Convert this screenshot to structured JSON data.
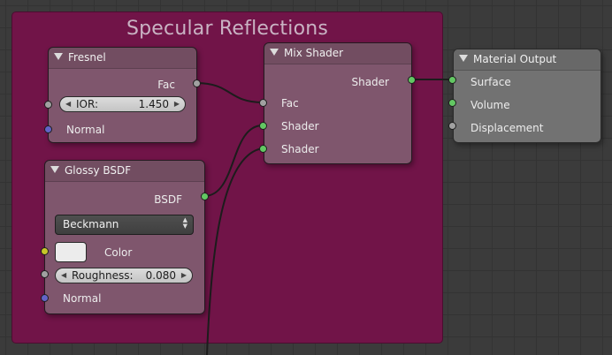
{
  "frame": {
    "title": "Specular Reflections",
    "color": "#711448"
  },
  "nodes": {
    "fresnel": {
      "title": "Fresnel",
      "output_fac": "Fac",
      "ior": {
        "label": "IOR:",
        "value": "1.450"
      },
      "input_normal": "Normal"
    },
    "glossy": {
      "title": "Glossy BSDF",
      "output_bsdf": "BSDF",
      "distribution": "Beckmann",
      "color_label": "Color",
      "color_value": "#ececec",
      "roughness": {
        "label": "Roughness:",
        "value": "0.080"
      },
      "input_normal": "Normal"
    },
    "mix": {
      "title": "Mix Shader",
      "output_shader": "Shader",
      "input_fac": "Fac",
      "input_shader_1": "Shader",
      "input_shader_2": "Shader"
    },
    "output": {
      "title": "Material Output",
      "input_surface": "Surface",
      "input_volume": "Volume",
      "input_displacement": "Displacement"
    }
  },
  "socket_colors": {
    "shader": "#63c763",
    "value": "#a1a1a1",
    "vector": "#6363c7",
    "color": "#c7c729"
  },
  "icons": {
    "collapse": "triangle-down-icon",
    "decrement": "left-arrow-icon",
    "increment": "right-arrow-icon",
    "dropdown": "updown-arrows-icon"
  }
}
